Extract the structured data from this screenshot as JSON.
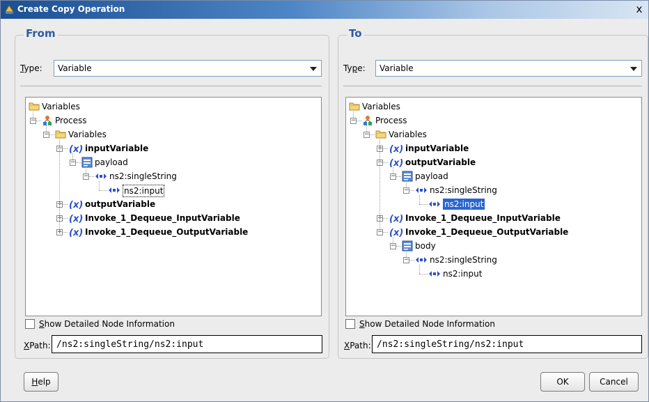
{
  "dialog": {
    "title": "Create Copy Operation",
    "close_glyph": "x"
  },
  "colors": {
    "heading": "#2f5aa3",
    "selection": "#2865d0",
    "variable_icon": "#2c50c8",
    "titlebar_start": "#1b4f93"
  },
  "from": {
    "heading": "From",
    "type_label_prefix": "T",
    "type_label_rest": "ype:",
    "type_value": "Variable",
    "tree": [
      {
        "label": "Variables",
        "icon": "folder-icon"
      },
      {
        "label": "Process",
        "icon": "process-icon",
        "expander": "−"
      },
      {
        "label": "Variables",
        "icon": "folder-icon",
        "expander": "−"
      },
      {
        "label": "inputVariable",
        "icon": "variable-icon",
        "expander": "−",
        "bold": true
      },
      {
        "label": "payload",
        "icon": "message-part-icon",
        "expander": "−"
      },
      {
        "label": "ns2:singleString",
        "icon": "element-icon",
        "expander": "−"
      },
      {
        "label": "ns2:input",
        "icon": "element-icon",
        "focused": true
      },
      {
        "label": "outputVariable",
        "icon": "variable-icon",
        "expander": "+",
        "bold": true
      },
      {
        "label": "Invoke_1_Dequeue_InputVariable",
        "icon": "variable-icon",
        "expander": "+",
        "bold": true
      },
      {
        "label": "Invoke_1_Dequeue_OutputVariable",
        "icon": "variable-icon",
        "expander": "+",
        "bold": true
      }
    ],
    "show_details_prefix": "S",
    "show_details_rest": "how Detailed Node Information",
    "show_details_checked": false,
    "xpath_label_prefix": "X",
    "xpath_label_rest": "Path:",
    "xpath_value": "/ns2:singleString/ns2:input"
  },
  "to": {
    "heading": "To",
    "type_label_prefix": "Ty",
    "type_label_mnemonic": "p",
    "type_label_rest": "e:",
    "type_value": "Variable",
    "tree": [
      {
        "label": "Variables",
        "icon": "folder-icon"
      },
      {
        "label": "Process",
        "icon": "process-icon",
        "expander": "−"
      },
      {
        "label": "Variables",
        "icon": "folder-icon",
        "expander": "−"
      },
      {
        "label": "inputVariable",
        "icon": "variable-icon",
        "expander": "+",
        "bold": true
      },
      {
        "label": "outputVariable",
        "icon": "variable-icon",
        "expander": "−",
        "bold": true
      },
      {
        "label": "payload",
        "icon": "message-part-icon",
        "expander": "−"
      },
      {
        "label": "ns2:singleString",
        "icon": "element-icon",
        "expander": "−"
      },
      {
        "label": "ns2:input",
        "icon": "element-icon",
        "selected": true
      },
      {
        "label": "Invoke_1_Dequeue_InputVariable",
        "icon": "variable-icon",
        "expander": "+",
        "bold": true
      },
      {
        "label": "Invoke_1_Dequeue_OutputVariable",
        "icon": "variable-icon",
        "expander": "−",
        "bold": true
      },
      {
        "label": "body",
        "icon": "message-part-icon",
        "expander": "−"
      },
      {
        "label": "ns2:singleString",
        "icon": "element-icon",
        "expander": "−"
      },
      {
        "label": "ns2:input",
        "icon": "element-icon"
      }
    ],
    "show_details_prefix": "S",
    "show_details_rest": "how Detailed Node Information",
    "show_details_checked": false,
    "xpath_label_prefix": "X",
    "xpath_label_rest": "Path:",
    "xpath_value": "/ns2:singleString/ns2:input"
  },
  "buttons": {
    "help_prefix": "H",
    "help_rest": "elp",
    "ok": "OK",
    "cancel": "Cancel"
  }
}
